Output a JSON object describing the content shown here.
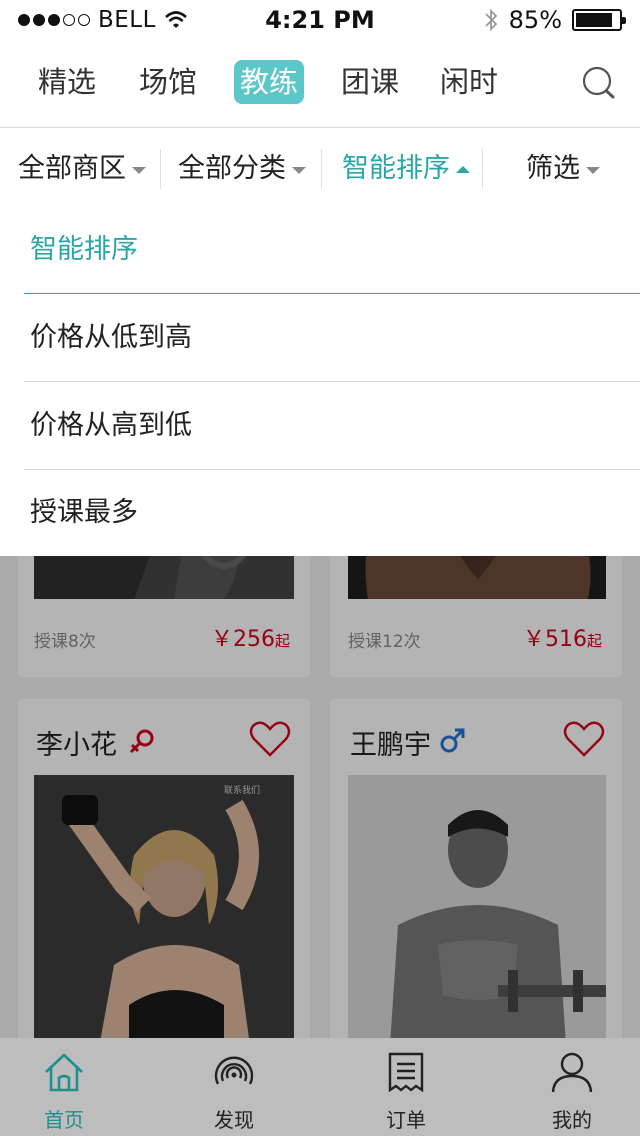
{
  "status_bar": {
    "carrier": "BELL",
    "time": "4:21 PM",
    "battery": "85%",
    "battery_level": 0.85
  },
  "top_nav": {
    "tabs": [
      {
        "label": "精选"
      },
      {
        "label": "场馆"
      },
      {
        "label": "教练",
        "active": true
      },
      {
        "label": "团课"
      },
      {
        "label": "闲时"
      }
    ]
  },
  "filter_bar": {
    "items": [
      {
        "label": "全部商区"
      },
      {
        "label": "全部分类"
      },
      {
        "label": "智能排序",
        "active": true
      },
      {
        "label": "筛选"
      }
    ]
  },
  "sort_dropdown": {
    "options": [
      {
        "label": "智能排序",
        "selected": true
      },
      {
        "label": "价格从低到高"
      },
      {
        "label": "价格从高到低"
      },
      {
        "label": "授课最多"
      }
    ]
  },
  "coaches_row1": [
    {
      "lessons": "授课8次",
      "price": "￥256",
      "price_suffix": "起"
    },
    {
      "lessons": "授课12次",
      "price": "￥516",
      "price_suffix": "起"
    }
  ],
  "coaches_row2": [
    {
      "name": "李小花",
      "gender": "female",
      "photo_caption": "联系我们"
    },
    {
      "name": "王鹏宇",
      "gender": "male"
    }
  ],
  "tab_bar": {
    "tabs": [
      {
        "label": "首页",
        "icon": "home-icon",
        "active": true
      },
      {
        "label": "发现",
        "icon": "discover-icon"
      },
      {
        "label": "订单",
        "icon": "order-icon"
      },
      {
        "label": "我的",
        "icon": "profile-icon"
      }
    ]
  },
  "colors": {
    "accent": "#5cc7c9",
    "accent_text": "#2aa6a6",
    "price": "#d0021b",
    "female": "#d0021b",
    "male": "#2a6fd1"
  }
}
